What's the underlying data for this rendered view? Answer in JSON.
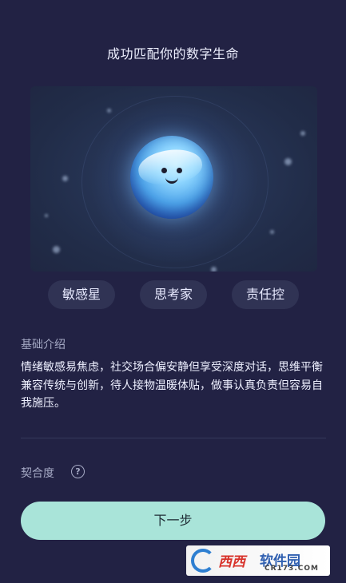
{
  "header": {
    "title": "成功匹配你的数字生命"
  },
  "avatar": {
    "name": "digital-life-orb"
  },
  "tags": [
    "敏感星",
    "思考家",
    "责任控"
  ],
  "intro": {
    "label": "基础介绍",
    "text": "情绪敏感易焦虑，社交场合偏安静但享受深度对话，思维平衡兼容传统与创新，待人接物温暖体贴，做事认真负责但容易自我施压。"
  },
  "match": {
    "label": "契合度",
    "help_icon": "?",
    "value_visible": ""
  },
  "actions": {
    "next_label": "下一步"
  },
  "watermark": {
    "brand": "软件园",
    "prefix": "西西",
    "url": "CR173.COM"
  },
  "colors": {
    "background": "#222244",
    "button": "#a9e4d9",
    "tag_bg": "#303354"
  }
}
